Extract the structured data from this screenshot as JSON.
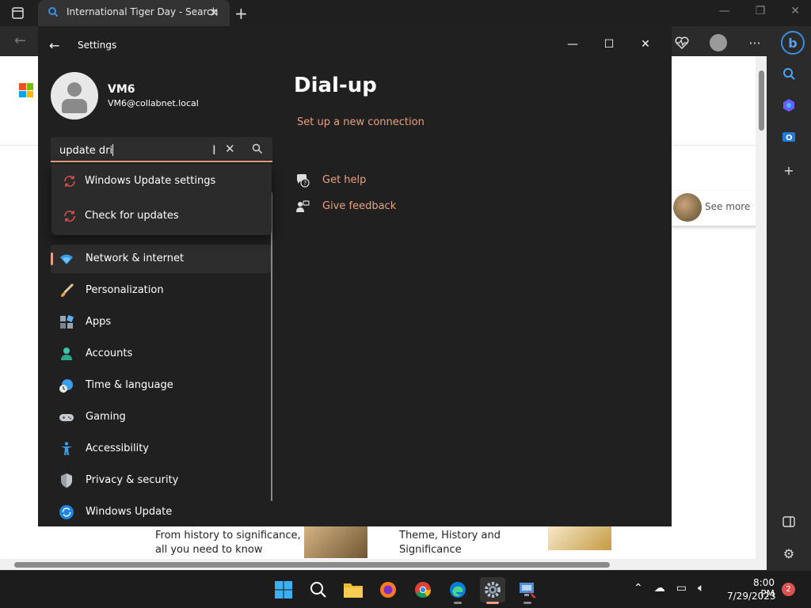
{
  "browser": {
    "tab_title": "International Tiger Day - Search",
    "see_more": "See more",
    "article_1": "From history to significance, all you need to know",
    "article_2": "Theme, History and Significance"
  },
  "settings": {
    "window_title": "Settings",
    "user": {
      "name": "VM6",
      "email": "VM6@collabnet.local"
    },
    "search": {
      "value": "update dri"
    },
    "suggestions": [
      {
        "label": "Windows Update settings",
        "icon": "sync-icon"
      },
      {
        "label": "Check for updates",
        "icon": "sync-icon"
      }
    ],
    "nav": [
      {
        "label": "Network & internet",
        "icon": "wifi-icon",
        "selected": true
      },
      {
        "label": "Personalization",
        "icon": "brush-icon"
      },
      {
        "label": "Apps",
        "icon": "apps-icon"
      },
      {
        "label": "Accounts",
        "icon": "person-icon"
      },
      {
        "label": "Time & language",
        "icon": "globe-clock-icon"
      },
      {
        "label": "Gaming",
        "icon": "controller-icon"
      },
      {
        "label": "Accessibility",
        "icon": "accessibility-icon"
      },
      {
        "label": "Privacy & security",
        "icon": "shield-icon"
      },
      {
        "label": "Windows Update",
        "icon": "windows-update-icon"
      }
    ],
    "page": {
      "title": "Dial-up",
      "setup_link": "Set up a new connection",
      "get_help": "Get help",
      "give_feedback": "Give feedback"
    }
  },
  "taskbar": {
    "time": "8:00 PM",
    "date": "7/29/2023",
    "notification_count": "2"
  },
  "colors": {
    "accent": "#e8a080",
    "settings_bg": "#202020",
    "taskbar_bg": "#1c1c1c"
  }
}
